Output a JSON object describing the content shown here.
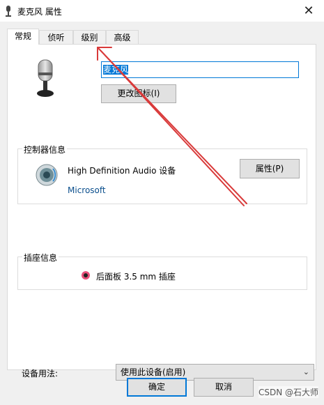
{
  "window": {
    "title": "麦克风 属性",
    "close_glyph": "✕"
  },
  "tabs": [
    {
      "label": "常规",
      "active": true
    },
    {
      "label": "侦听",
      "active": false
    },
    {
      "label": "级别",
      "active": false
    },
    {
      "label": "高级",
      "active": false
    }
  ],
  "general": {
    "device_name_value": "麦克风",
    "change_icon_label": "更改图标(I)",
    "controller": {
      "legend": "控制器信息",
      "name": "High Definition Audio 设备",
      "vendor": "Microsoft",
      "properties_label": "属性(P)"
    },
    "jack": {
      "legend": "插座信息",
      "description": "后面板 3.5 mm 插座",
      "color": "#e8507a"
    },
    "usage": {
      "label": "设备用法:",
      "selected": "使用此设备(启用)"
    }
  },
  "footer": {
    "ok_label": "确定",
    "cancel_label": "取消"
  },
  "watermark": "CSDN @石大师",
  "annotation": {
    "color": "#d93a3a"
  }
}
